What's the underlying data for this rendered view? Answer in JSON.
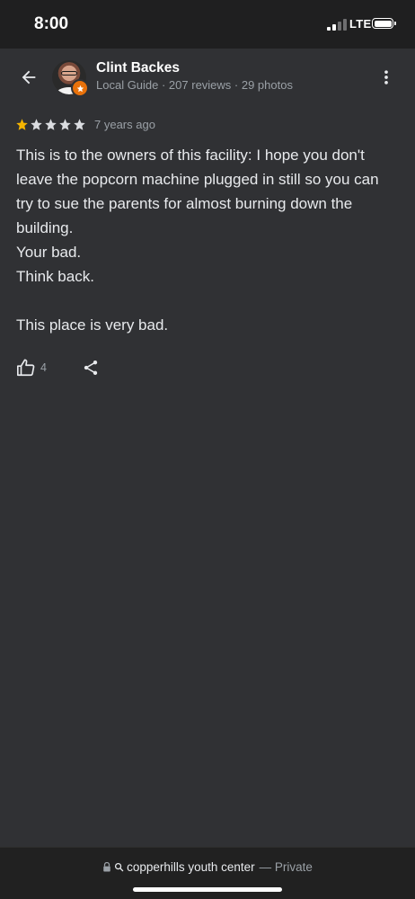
{
  "status_bar": {
    "time": "8:00",
    "network": "LTE"
  },
  "reviewer": {
    "name": "Clint Backes",
    "meta": "Local Guide · 207 reviews · 29 photos"
  },
  "review": {
    "rating": 1,
    "max_rating": 5,
    "time_ago": "7 years ago",
    "paragraphs": [
      "This is to the owners of this facility: I hope you don't leave the popcorn machine plugged in still so you can try to sue the parents for almost burning down the building.",
      "Your bad.",
      "Think back.",
      "",
      "This place is very bad."
    ],
    "likes": "4"
  },
  "url_bar": {
    "site": "copperhills youth center",
    "suffix": "— Private"
  },
  "icons": {
    "back": "arrow-back-icon",
    "overflow": "more-vert-icon",
    "like": "thumb-up-icon",
    "share": "share-icon",
    "lock": "lock-icon",
    "search": "search-icon",
    "badge": "local-guide-badge-icon"
  },
  "colors": {
    "background": "#303134",
    "star_filled": "#f4b400",
    "star_empty": "#dadce0",
    "badge": "#e8710a"
  }
}
